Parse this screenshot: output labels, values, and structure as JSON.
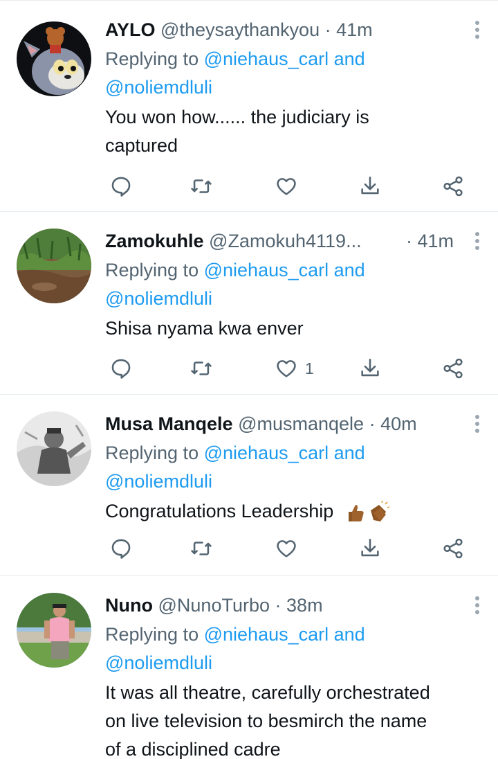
{
  "tweets": [
    {
      "name": "AYLO",
      "handle": "@theysaythankyou",
      "separator": "·",
      "time": "41m",
      "reply_prefix": "Replying to",
      "reply_to_1": "@niehaus_carl",
      "reply_and": "and",
      "reply_to_2": "@noliemdluli",
      "text_lines": [
        "You won how...... the judiciary is",
        "captured"
      ],
      "like_count": ""
    },
    {
      "name": "Zamokuhle",
      "handle": "@Zamokuh4119...",
      "separator": "·",
      "time": "41m",
      "reply_prefix": "Replying to",
      "reply_to_1": "@niehaus_carl",
      "reply_and": "and",
      "reply_to_2": "@noliemdluli",
      "text_lines": [
        "Shisa nyama kwa enver"
      ],
      "like_count": "1"
    },
    {
      "name": "Musa Manqele",
      "handle": "@musmanqele",
      "separator": "·",
      "time": "40m",
      "reply_prefix": "Replying to",
      "reply_to_1": "@niehaus_carl",
      "reply_and": "and",
      "reply_to_2": "@noliemdluli",
      "text_lines": [
        "Congratulations Leadership"
      ],
      "like_count": ""
    },
    {
      "name": "Nuno",
      "handle": "@NunoTurbo",
      "separator": "·",
      "time": "38m",
      "reply_prefix": "Replying to",
      "reply_to_1": "@niehaus_carl",
      "reply_and": "and",
      "reply_to_2": "@noliemdluli",
      "text_lines": [
        "It was all theatre, carefully orchestrated",
        "on live television to besmirch the name",
        "of a disciplined cadre"
      ],
      "like_count": ""
    }
  ],
  "icons": {
    "reply": "reply-icon",
    "retweet": "retweet-icon",
    "like": "heart-icon",
    "bookmark": "bookmark-download-icon",
    "share": "share-icon",
    "more": "more-vertical-icon"
  },
  "colors": {
    "text": "#0f1419",
    "secondary": "#536471",
    "link": "#1d9bf0",
    "divider": "#e6ecf0"
  }
}
